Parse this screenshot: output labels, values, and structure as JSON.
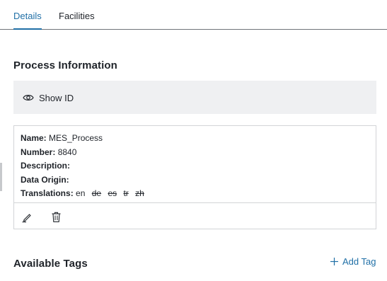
{
  "tabs": [
    {
      "label": "Details",
      "active": true
    },
    {
      "label": "Facilities",
      "active": false
    }
  ],
  "process_info": {
    "title": "Process Information",
    "show_id_label": "Show ID",
    "name_key": "Name:",
    "name_value": "MES_Process",
    "number_key": "Number:",
    "number_value": "8840",
    "description_key": "Description:",
    "description_value": "",
    "data_origin_key": "Data Origin:",
    "data_origin_value": "",
    "translations_key": "Translations:",
    "translations": [
      {
        "code": "en",
        "available": true
      },
      {
        "code": "de",
        "available": false
      },
      {
        "code": "es",
        "available": false
      },
      {
        "code": "tr",
        "available": false
      },
      {
        "code": "zh",
        "available": false
      }
    ]
  },
  "tags": {
    "title": "Available Tags",
    "add_label": "Add Tag"
  },
  "icons": {
    "show_id": "eye-icon",
    "edit": "pencil-icon",
    "delete": "trash-icon",
    "add": "plus-icon"
  },
  "colors": {
    "accent": "#1f6fa6",
    "text": "#1f2329",
    "bar_bg": "#eff0f2",
    "border": "#d2d4d7"
  }
}
